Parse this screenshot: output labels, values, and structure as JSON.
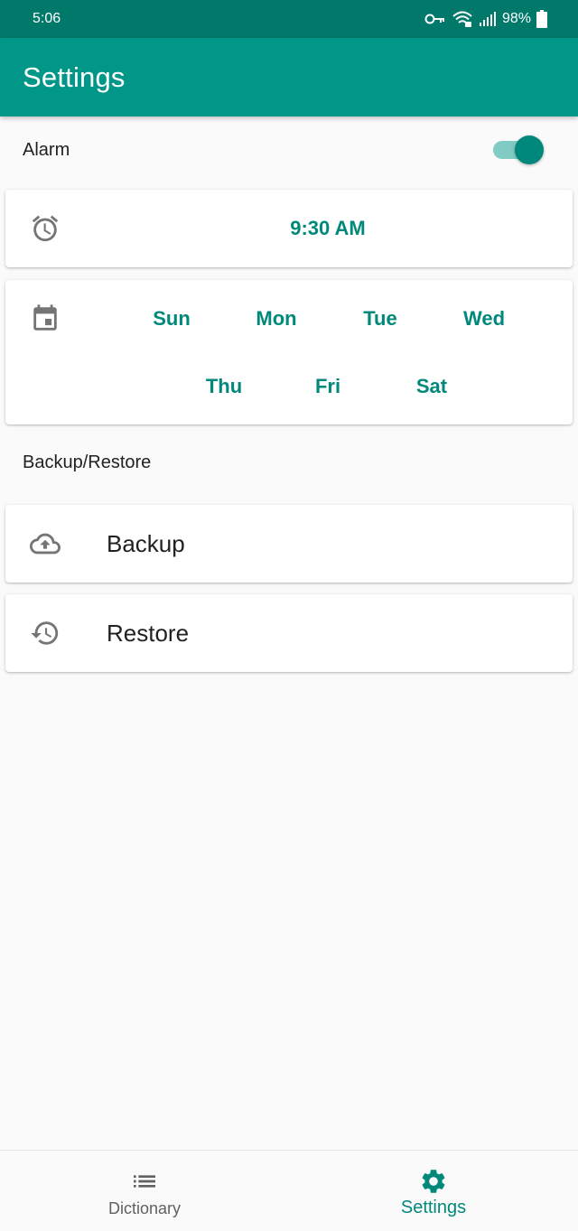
{
  "status_bar": {
    "time": "5:06",
    "battery": "98%",
    "icons": [
      "vpn-key-icon",
      "wifi-icon",
      "signal-icon",
      "battery-icon"
    ]
  },
  "app_bar": {
    "title": "Settings"
  },
  "alarm": {
    "label": "Alarm",
    "enabled": true,
    "time": "9:30 AM",
    "days": [
      "Sun",
      "Mon",
      "Tue",
      "Wed",
      "Thu",
      "Fri",
      "Sat"
    ]
  },
  "backup_section": {
    "header": "Backup/Restore",
    "backup_label": "Backup",
    "restore_label": "Restore"
  },
  "bottom_nav": {
    "items": [
      {
        "label": "Dictionary",
        "icon": "list-icon",
        "active": false
      },
      {
        "label": "Settings",
        "icon": "gear-icon",
        "active": true
      }
    ]
  },
  "colors": {
    "primary": "#009688",
    "primary_dark": "#00796b",
    "accent": "#00897b",
    "background": "#fafafa"
  }
}
